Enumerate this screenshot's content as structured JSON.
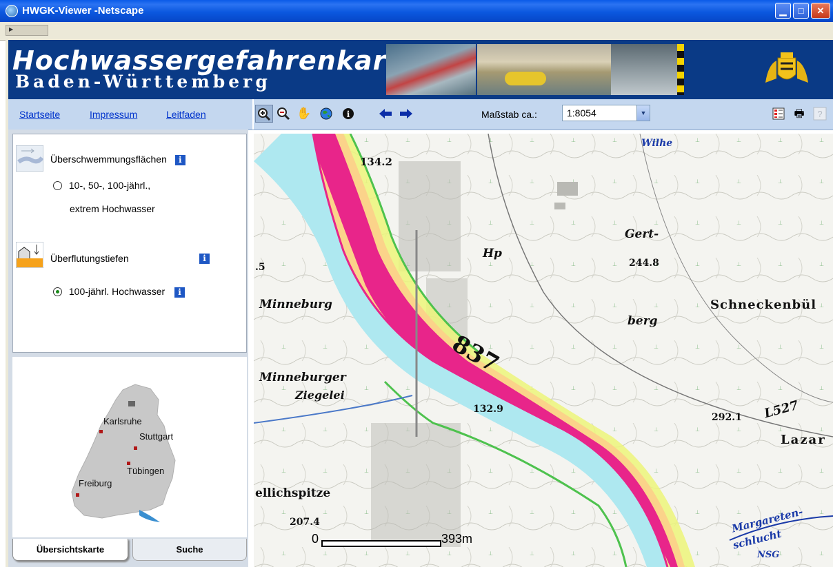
{
  "window": {
    "title": "HWGK-Viewer -Netscape"
  },
  "banner": {
    "title_main": "Hochwassergefahrenkarte",
    "title_sub": "Baden-Württemberg"
  },
  "nav": {
    "links": [
      "Startseite",
      "Impressum",
      "Leitfaden"
    ]
  },
  "toolbar": {
    "tools": [
      "zoom-in",
      "zoom-out",
      "pan",
      "full-extent",
      "info",
      "back",
      "forward"
    ],
    "scale_label": "Maßstab ca.:",
    "scale_value": "1:8054"
  },
  "layers": {
    "flood_areas_label": "Überschwemmungsflächen",
    "flood_areas_option_line1": "10-, 50-, 100-jährl.,",
    "flood_areas_option_line2": "extrem Hochwasser",
    "flood_depth_label": "Überflutungstiefen",
    "flood_depth_option": "100-jährl. Hochwasser",
    "selected_option": "100-jährl. Hochwasser"
  },
  "overview": {
    "cities": [
      "Karlsruhe",
      "Stuttgart",
      "Tübingen",
      "Freiburg"
    ]
  },
  "tabs": {
    "overview": "Übersichtskarte",
    "search": "Suche",
    "active": "Übersichtskarte"
  },
  "map": {
    "labels": {
      "spot_134": "134.2",
      "gert": "Gert-",
      "berg": "berg",
      "spot_244": "244.8",
      "schneckenbuhl": "Schneckenbül",
      "minneburg": "Minneburg",
      "minneburger": "Minneburger",
      "ziegelei": "Ziegelei",
      "road_837": "837",
      "spot_132": "132.9",
      "spot_292": "292.1",
      "l527": "L527",
      "lazar": "Lazar",
      "hp": "Hp",
      "ellichspitze": "ellichspitze",
      "spot_207": "207.4",
      "margareten": "Margareten-",
      "schlucht": "schlucht",
      "nsg": "NSG",
      "wilhelmsfeld": "Wilhe",
      "left_5": ".5"
    },
    "scalebar": {
      "start": "0",
      "end": "393m"
    }
  },
  "colors": {
    "banner": "#0a3a86",
    "nav": "#c4d7ef",
    "river": "#aee8f0",
    "flood_magenta": "#e8258a",
    "flood_yellow": "#fbe48a"
  }
}
